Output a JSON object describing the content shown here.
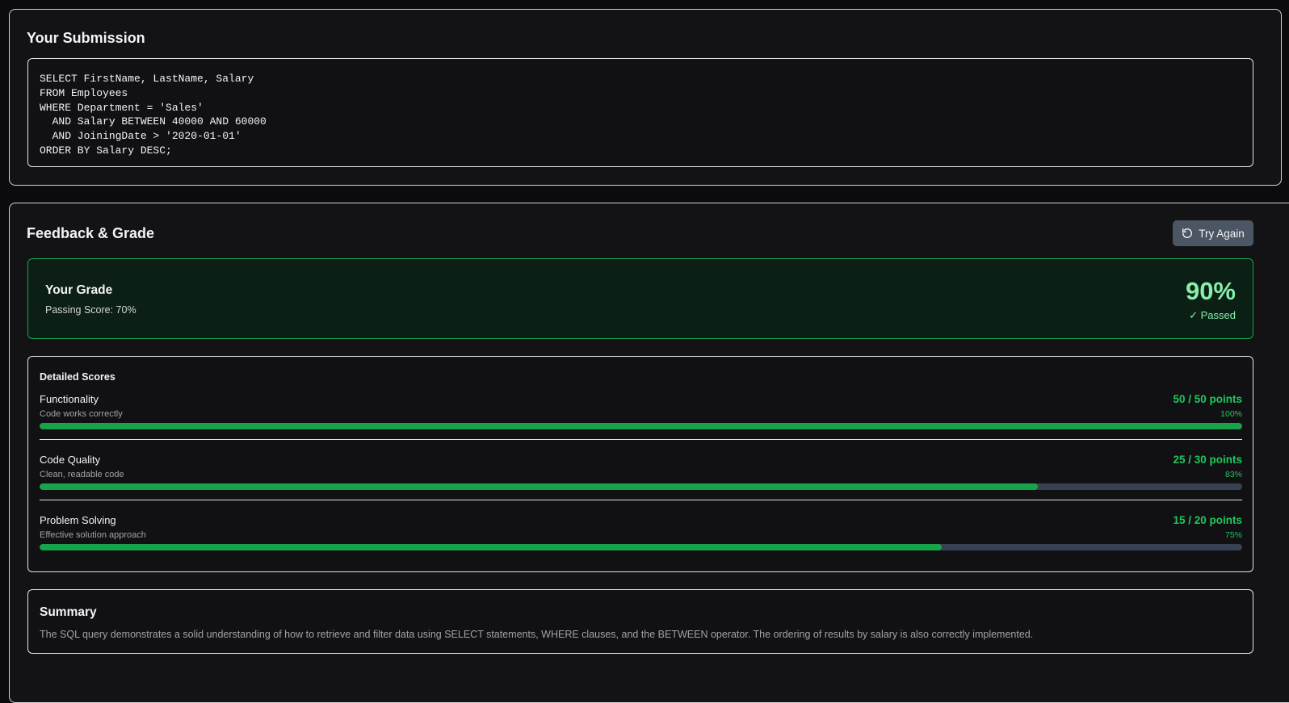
{
  "submission": {
    "title": "Your Submission",
    "code": "SELECT FirstName, LastName, Salary\nFROM Employees\nWHERE Department = 'Sales'\n  AND Salary BETWEEN 40000 AND 60000\n  AND JoiningDate > '2020-01-01'\nORDER BY Salary DESC;"
  },
  "feedback": {
    "title": "Feedback & Grade",
    "try_again_label": "Try Again",
    "try_again_icon": "rotate-ccw-icon",
    "grade": {
      "title": "Your Grade",
      "passing_score": "Passing Score: 70%",
      "percentage": "90%",
      "status": "✓ Passed"
    },
    "detailed_scores": {
      "title": "Detailed Scores",
      "items": [
        {
          "name": "Functionality",
          "description": "Code works correctly",
          "points": "50 / 50 points",
          "percent_label": "100%",
          "fill_fraction": 1.0
        },
        {
          "name": "Code Quality",
          "description": "Clean, readable code",
          "points": "25 / 30 points",
          "percent_label": "83%",
          "fill_fraction": 0.83
        },
        {
          "name": "Problem Solving",
          "description": "Effective solution approach",
          "points": "15 / 20 points",
          "percent_label": "75%",
          "fill_fraction": 0.75
        }
      ]
    },
    "summary": {
      "title": "Summary",
      "text": "The SQL query demonstrates a solid understanding of how to retrieve and filter data using SELECT statements, WHERE clauses, and the BETWEEN operator. The ordering of results by salary is also correctly implemented."
    }
  },
  "colors": {
    "accent_green": "#22c55e",
    "bar_fill": "#16a34a",
    "bar_track": "#374151",
    "grade_text": "#86efac",
    "grade_bg": "#0c1f15",
    "button_bg": "#4b5563"
  }
}
